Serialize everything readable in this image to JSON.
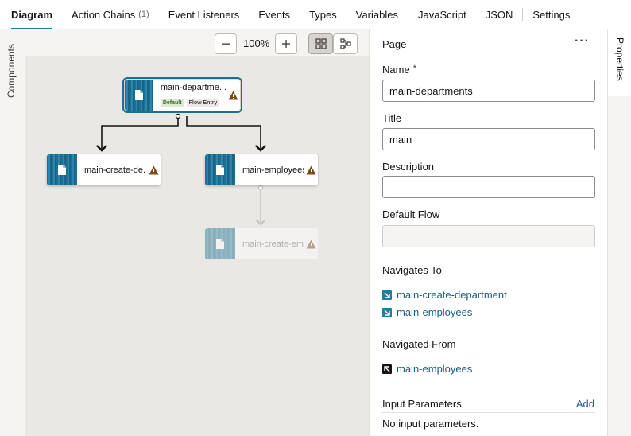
{
  "tabs": [
    {
      "label": "Diagram"
    },
    {
      "label": "Action Chains",
      "count": "(1)"
    },
    {
      "label": "Event Listeners"
    },
    {
      "label": "Events"
    },
    {
      "label": "Types"
    },
    {
      "label": "Variables"
    },
    {
      "label": "JavaScript"
    },
    {
      "label": "JSON"
    },
    {
      "label": "Settings"
    }
  ],
  "left_rail": {
    "label": "Components"
  },
  "right_rail": {
    "label": "Properties"
  },
  "toolbar": {
    "zoom_out_icon": "minus-icon",
    "zoom_level": "100%",
    "zoom_in_icon": "plus-icon",
    "grid_view_icon": "grid-icon",
    "flow_view_icon": "flow-layout-icon"
  },
  "diagram": {
    "nodes": [
      {
        "label": "main-departme...",
        "badges": [
          "Default",
          "Flow Entry"
        ],
        "selected": true
      },
      {
        "label": "main-create-de..."
      },
      {
        "label": "main-employees"
      },
      {
        "label": "main-create-em...",
        "faded": true
      }
    ]
  },
  "properties": {
    "header": "Page",
    "more_icon": "more-icon",
    "name_label": "Name",
    "name_required": "*",
    "name_value": "main-departments",
    "title_label": "Title",
    "title_value": "main",
    "description_label": "Description",
    "description_value": "",
    "default_flow_label": "Default Flow",
    "default_flow_value": "",
    "navigates_to_label": "Navigates To",
    "navigates_to": [
      {
        "label": "main-create-department",
        "icon": "arrow-down-right-icon"
      },
      {
        "label": "main-employees",
        "icon": "arrow-down-right-icon"
      }
    ],
    "navigated_from_label": "Navigated From",
    "navigated_from": [
      {
        "label": "main-employees",
        "icon": "arrow-up-left-icon"
      }
    ],
    "input_params_label": "Input Parameters",
    "add_label": "Add",
    "no_params_text": "No input parameters."
  },
  "colors": {
    "accent": "#227e9e",
    "link": "#1c5d85",
    "node_thumb": "#1e6f94",
    "warning": "#7a4a12"
  }
}
